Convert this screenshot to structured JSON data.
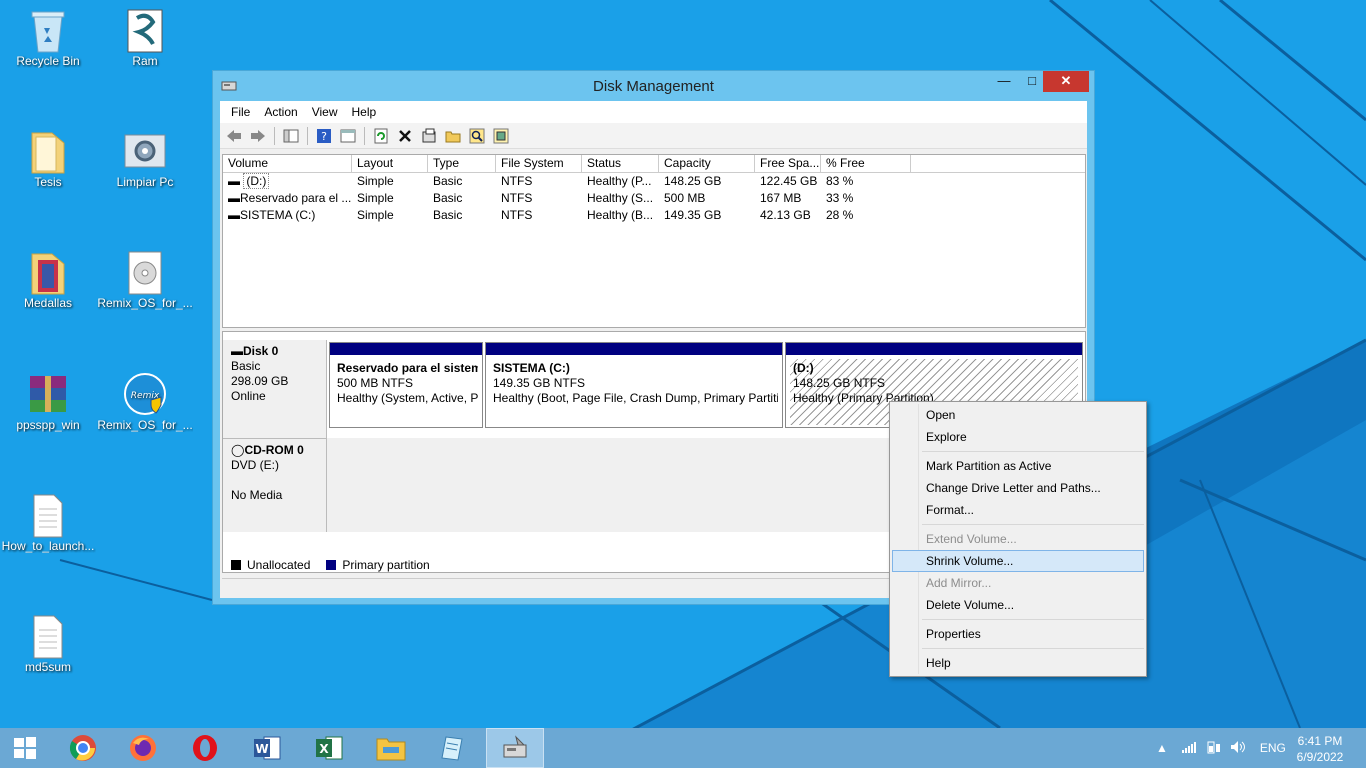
{
  "desktop": {
    "icons": [
      {
        "label": "Recycle Bin"
      },
      {
        "label": "Ram"
      },
      {
        "label": "Tesis"
      },
      {
        "label": "Limpiar Pc"
      },
      {
        "label": "Medallas"
      },
      {
        "label": "Remix_OS_for_..."
      },
      {
        "label": "ppsspp_win"
      },
      {
        "label": "Remix_OS_for_..."
      },
      {
        "label": "How_to_launch..."
      },
      {
        "label": "md5sum"
      }
    ]
  },
  "window": {
    "title": "Disk Management",
    "menu": [
      "File",
      "Action",
      "View",
      "Help"
    ]
  },
  "volumes": {
    "columns": [
      "Volume",
      "Layout",
      "Type",
      "File System",
      "Status",
      "Capacity",
      "Free Spa...",
      "% Free"
    ],
    "rows": [
      [
        "(D:)",
        "Simple",
        "Basic",
        "NTFS",
        "Healthy (P...",
        "148.25 GB",
        "122.45 GB",
        "83 %"
      ],
      [
        "Reservado para el ...",
        "Simple",
        "Basic",
        "NTFS",
        "Healthy (S...",
        "500 MB",
        "167 MB",
        "33 %"
      ],
      [
        "SISTEMA (C:)",
        "Simple",
        "Basic",
        "NTFS",
        "Healthy (B...",
        "149.35 GB",
        "42.13 GB",
        "28 %"
      ]
    ]
  },
  "disks": {
    "disk0": {
      "name": "Disk 0",
      "type": "Basic",
      "size": "298.09 GB",
      "state": "Online"
    },
    "cdrom0": {
      "name": "CD-ROM 0",
      "drive": "DVD (E:)",
      "media": "No Media"
    },
    "partitions": [
      {
        "title": "Reservado para el sistema",
        "size": "500 MB NTFS",
        "status": "Healthy (System, Active, Primary Partition)"
      },
      {
        "title": "SISTEMA  (C:)",
        "size": "149.35 GB NTFS",
        "status": "Healthy (Boot, Page File, Crash Dump, Primary Partition)"
      },
      {
        "title": "(D:)",
        "size": "148.25 GB NTFS",
        "status": "Healthy (Primary Partition)"
      }
    ]
  },
  "legend": {
    "unallocated": "Unallocated",
    "primary": "Primary partition",
    "unallocated_color": "#000000",
    "primary_color": "#000080"
  },
  "context_menu": {
    "open": "Open",
    "explore": "Explore",
    "mark_active": "Mark Partition as Active",
    "change_letter": "Change Drive Letter and Paths...",
    "format": "Format...",
    "extend": "Extend Volume...",
    "shrink": "Shrink Volume...",
    "add_mirror": "Add Mirror...",
    "delete": "Delete Volume...",
    "properties": "Properties",
    "help": "Help"
  },
  "taskbar": {
    "lang": "ENG",
    "time": "6:41 PM",
    "date": "6/9/2022"
  }
}
